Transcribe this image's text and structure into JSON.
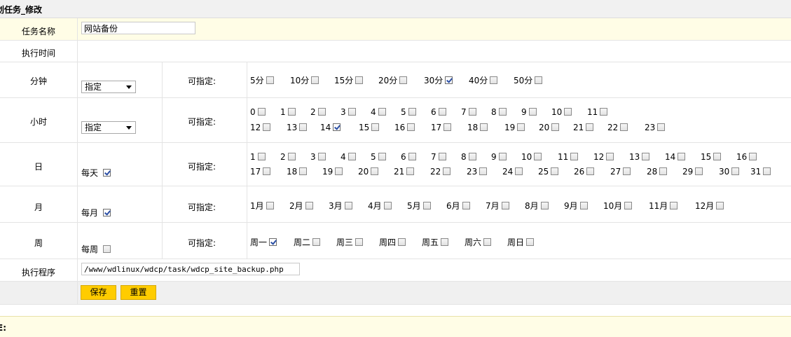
{
  "page": {
    "title": "划任务_修改"
  },
  "task_name": {
    "label": "任务名称",
    "value": "网站备份"
  },
  "exec_time": {
    "label": "执行时间"
  },
  "hint": "可指定:",
  "minute": {
    "label": "分钟",
    "select": "指定",
    "options": [
      {
        "label": "5分",
        "checked": false
      },
      {
        "label": "10分",
        "checked": false
      },
      {
        "label": "15分",
        "checked": false
      },
      {
        "label": "20分",
        "checked": false
      },
      {
        "label": "30分",
        "checked": true
      },
      {
        "label": "40分",
        "checked": false
      },
      {
        "label": "50分",
        "checked": false
      }
    ]
  },
  "hour": {
    "label": "小时",
    "select": "指定",
    "rows": [
      [
        {
          "label": "0",
          "checked": false
        },
        {
          "label": "1",
          "checked": false
        },
        {
          "label": "2",
          "checked": false
        },
        {
          "label": "3",
          "checked": false
        },
        {
          "label": "4",
          "checked": false
        },
        {
          "label": "5",
          "checked": false
        },
        {
          "label": "6",
          "checked": false
        },
        {
          "label": "7",
          "checked": false
        },
        {
          "label": "8",
          "checked": false
        },
        {
          "label": "9",
          "checked": false
        },
        {
          "label": "10",
          "checked": false
        },
        {
          "label": "11",
          "checked": false
        }
      ],
      [
        {
          "label": "12",
          "checked": false
        },
        {
          "label": "13",
          "checked": false
        },
        {
          "label": "14",
          "checked": true
        },
        {
          "label": "15",
          "checked": false
        },
        {
          "label": "16",
          "checked": false
        },
        {
          "label": "17",
          "checked": false
        },
        {
          "label": "18",
          "checked": false
        },
        {
          "label": "19",
          "checked": false
        },
        {
          "label": "20",
          "checked": false
        },
        {
          "label": "21",
          "checked": false
        },
        {
          "label": "22",
          "checked": false
        },
        {
          "label": "23",
          "checked": false
        }
      ]
    ]
  },
  "day": {
    "label": "日",
    "every_label": "每天",
    "every_checked": true,
    "rows": [
      [
        {
          "label": "1",
          "checked": false
        },
        {
          "label": "2",
          "checked": false
        },
        {
          "label": "3",
          "checked": false
        },
        {
          "label": "4",
          "checked": false
        },
        {
          "label": "5",
          "checked": false
        },
        {
          "label": "6",
          "checked": false
        },
        {
          "label": "7",
          "checked": false
        },
        {
          "label": "8",
          "checked": false
        },
        {
          "label": "9",
          "checked": false
        },
        {
          "label": "10",
          "checked": false
        },
        {
          "label": "11",
          "checked": false
        },
        {
          "label": "12",
          "checked": false
        },
        {
          "label": "13",
          "checked": false
        },
        {
          "label": "14",
          "checked": false
        },
        {
          "label": "15",
          "checked": false
        },
        {
          "label": "16",
          "checked": false
        }
      ],
      [
        {
          "label": "17",
          "checked": false
        },
        {
          "label": "18",
          "checked": false
        },
        {
          "label": "19",
          "checked": false
        },
        {
          "label": "20",
          "checked": false
        },
        {
          "label": "21",
          "checked": false
        },
        {
          "label": "22",
          "checked": false
        },
        {
          "label": "23",
          "checked": false
        },
        {
          "label": "24",
          "checked": false
        },
        {
          "label": "25",
          "checked": false
        },
        {
          "label": "26",
          "checked": false
        },
        {
          "label": "27",
          "checked": false
        },
        {
          "label": "28",
          "checked": false
        },
        {
          "label": "29",
          "checked": false
        },
        {
          "label": "30",
          "checked": false
        },
        {
          "label": "31",
          "checked": false
        }
      ]
    ]
  },
  "month": {
    "label": "月",
    "every_label": "每月",
    "every_checked": true,
    "options": [
      {
        "label": "1月",
        "checked": false
      },
      {
        "label": "2月",
        "checked": false
      },
      {
        "label": "3月",
        "checked": false
      },
      {
        "label": "4月",
        "checked": false
      },
      {
        "label": "5月",
        "checked": false
      },
      {
        "label": "6月",
        "checked": false
      },
      {
        "label": "7月",
        "checked": false
      },
      {
        "label": "8月",
        "checked": false
      },
      {
        "label": "9月",
        "checked": false
      },
      {
        "label": "10月",
        "checked": false
      },
      {
        "label": "11月",
        "checked": false
      },
      {
        "label": "12月",
        "checked": false
      }
    ]
  },
  "week": {
    "label": "周",
    "every_label": "每周",
    "every_checked": false,
    "options": [
      {
        "label": "周一",
        "checked": true
      },
      {
        "label": "周二",
        "checked": false
      },
      {
        "label": "周三",
        "checked": false
      },
      {
        "label": "周四",
        "checked": false
      },
      {
        "label": "周五",
        "checked": false
      },
      {
        "label": "周六",
        "checked": false
      },
      {
        "label": "周日",
        "checked": false
      }
    ]
  },
  "program": {
    "label": "执行程序",
    "value": "/www/wdlinux/wdcp/task/wdcp_site_backup.php"
  },
  "buttons": {
    "save": "保存",
    "reset": "重置"
  },
  "footer": {
    "label": "E:"
  }
}
